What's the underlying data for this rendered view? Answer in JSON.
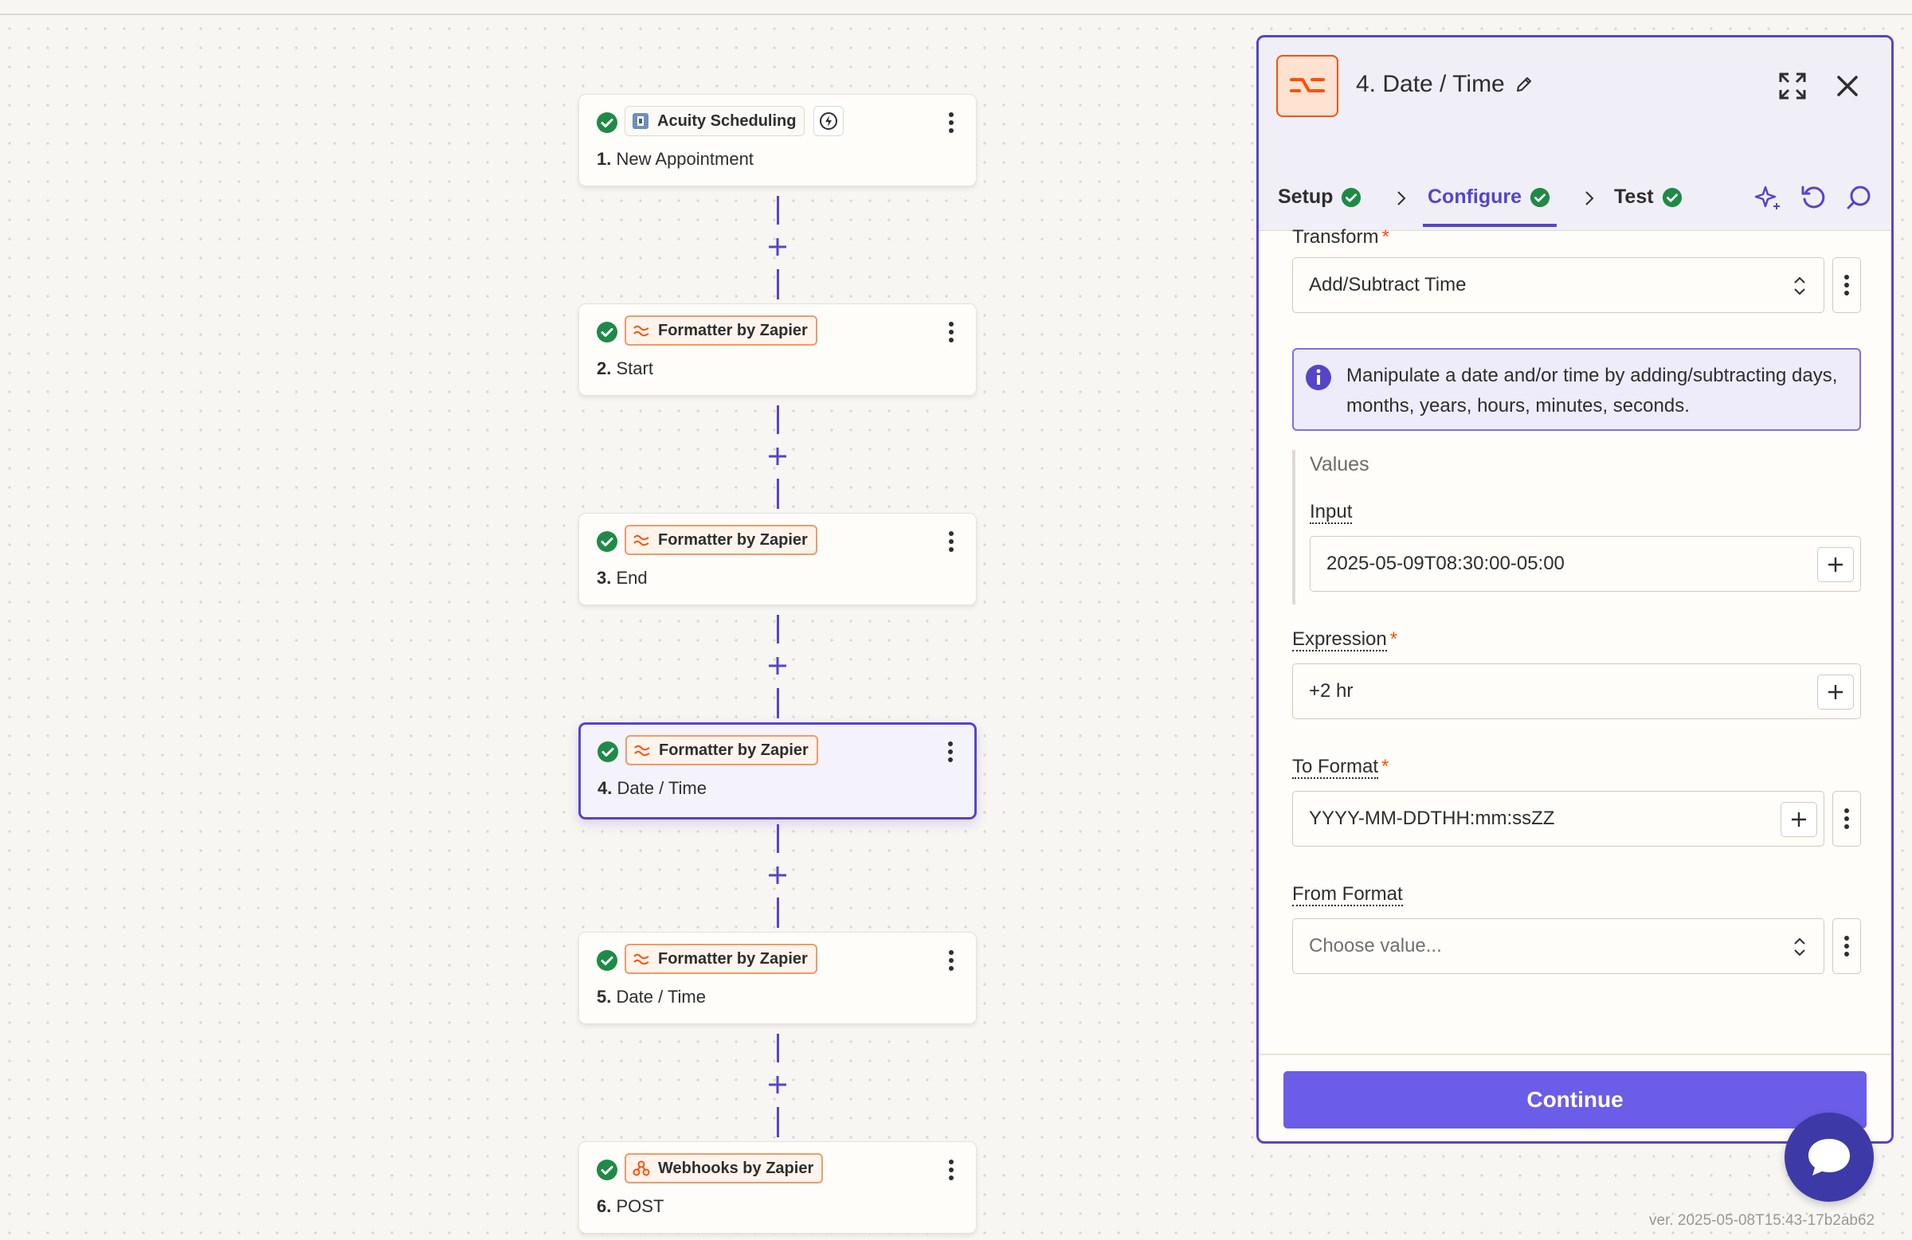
{
  "canvas": {
    "steps": [
      {
        "app": "Acuity Scheduling",
        "number": "1.",
        "name": "New Appointment",
        "icon": "acuity-icon",
        "has_trigger_bolt": true
      },
      {
        "app": "Formatter by Zapier",
        "number": "2.",
        "name": "Start",
        "icon": "formatter-icon"
      },
      {
        "app": "Formatter by Zapier",
        "number": "3.",
        "name": "End",
        "icon": "formatter-icon"
      },
      {
        "app": "Formatter by Zapier",
        "number": "4.",
        "name": "Date / Time",
        "icon": "formatter-icon",
        "selected": true
      },
      {
        "app": "Formatter by Zapier",
        "number": "5.",
        "name": "Date / Time",
        "icon": "formatter-icon"
      },
      {
        "app": "Webhooks by Zapier",
        "number": "6.",
        "name": "POST",
        "icon": "webhook-icon"
      }
    ]
  },
  "panel": {
    "title": "4. Date / Time",
    "tabs": [
      {
        "label": "Setup",
        "complete": true
      },
      {
        "label": "Configure",
        "complete": true,
        "active": true
      },
      {
        "label": "Test",
        "complete": true
      }
    ],
    "transform": {
      "label": "Transform",
      "value": "Add/Subtract Time"
    },
    "info": "Manipulate a date and/or time by adding/subtracting days, months, years, hours, minutes, seconds.",
    "values_heading": "Values",
    "input": {
      "label": "Input",
      "value": "2025-05-09T08:30:00-05:00"
    },
    "expression": {
      "label": "Expression",
      "value": "+2 hr"
    },
    "to_format": {
      "label": "To Format",
      "value": "YYYY-MM-DDTHH:mm:ssZZ"
    },
    "from_format": {
      "label": "From Format",
      "placeholder": "Choose value..."
    },
    "continue_label": "Continue"
  },
  "version": "ver. 2025-05-08T15:43-17b2ab62",
  "colors": {
    "accent": "#5545c9",
    "button": "#6b5de8",
    "brand_orange": "#ff4f00",
    "check_green": "#1f8a46"
  }
}
